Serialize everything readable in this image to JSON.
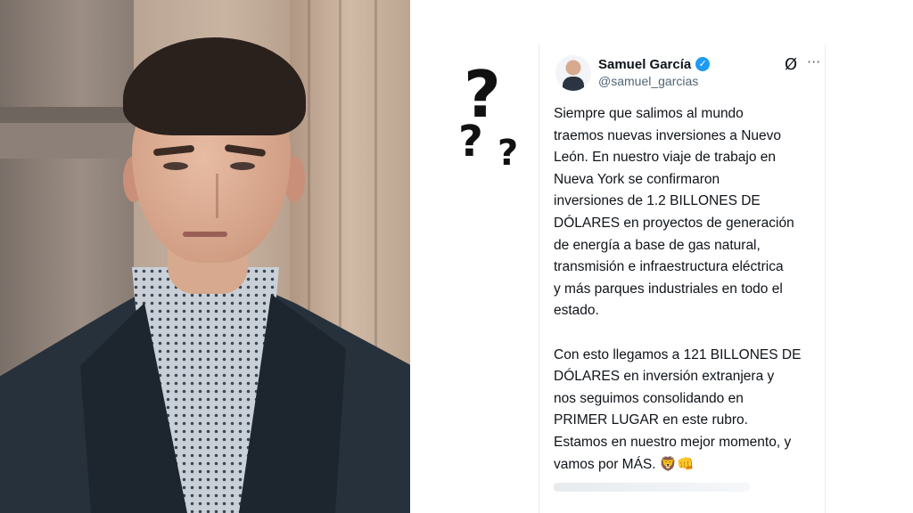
{
  "tweet": {
    "name": "Samuel García",
    "handle": "@samuel_garcias",
    "verified_icon": "✓",
    "grok_icon": "Ø",
    "more_icon": "···",
    "body": "Siempre que salimos al mundo\ntraemos nuevas inversiones a Nuevo\nLeón. En nuestro viaje de trabajo en\nNueva York se confirmaron\ninversiones de 1.2 BILLONES DE\nDÓLARES en proyectos de generación\nde energía a base de gas natural,\ntransmisión e infraestructura eléctrica\ny más parques industriales en todo el\nestado.\n\nCon esto llegamos a 121 BILLONES DE\nDÓLARES en inversión extranjera y\nnos seguimos consolidando en\nPRIMER LUGAR en este rubro.\nEstamos en nuestro mejor momento, y\nvamos por MÁS. 🦁👊",
    "accent_color": "#1d9bf0"
  },
  "decorations": {
    "question_marks": [
      "?",
      "?",
      "?"
    ]
  }
}
